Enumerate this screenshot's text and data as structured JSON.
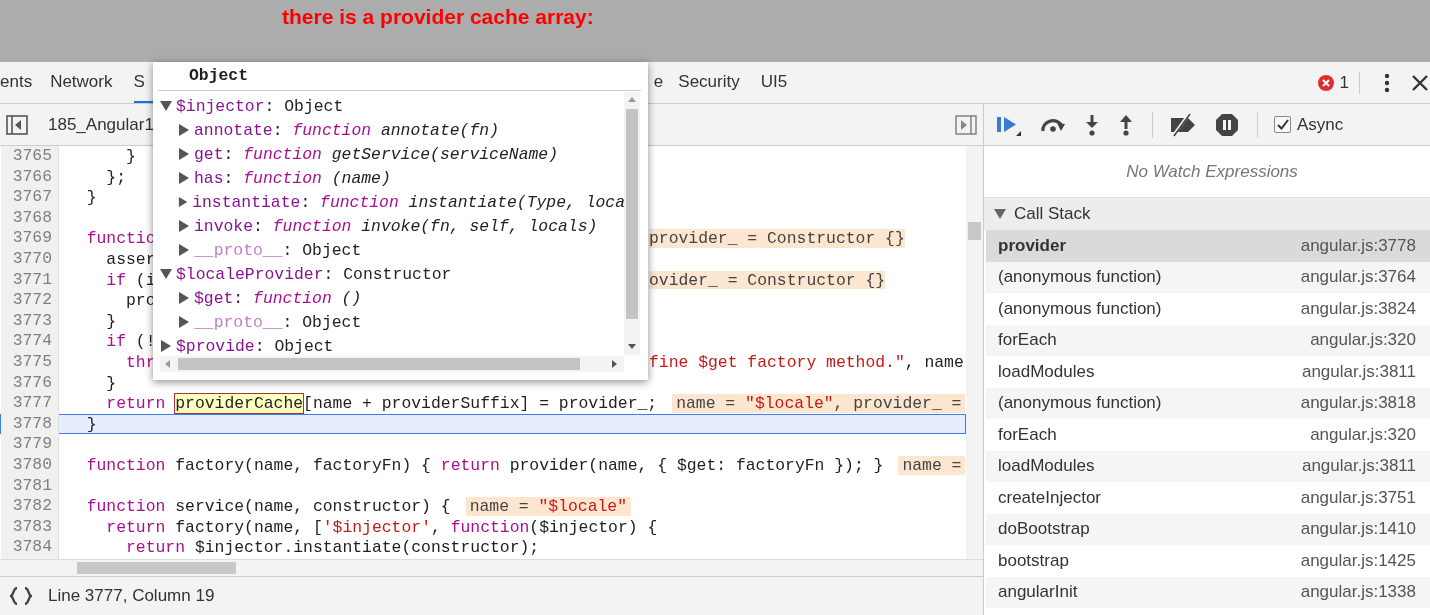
{
  "banner": {
    "text": "there is a provider cache array:"
  },
  "tabs": [
    {
      "label": "ents",
      "selected": false
    },
    {
      "label": "Network",
      "selected": false
    },
    {
      "label": "S",
      "selected": true
    },
    {
      "label": "e",
      "selected": false
    },
    {
      "label": "Security",
      "selected": false
    },
    {
      "label": "UI5",
      "selected": false
    }
  ],
  "errors": {
    "count": "1"
  },
  "editor": {
    "file_tab": "185_Angular1",
    "status": "Line 3777, Column 19",
    "lines": [
      {
        "number": "3765",
        "current": false,
        "tokens": [
          "      }"
        ]
      },
      {
        "number": "3766",
        "current": false,
        "tokens": [
          "    };"
        ]
      },
      {
        "number": "3767",
        "current": false,
        "tokens": [
          "  }"
        ]
      },
      {
        "number": "3768",
        "current": false
      },
      {
        "number": "3769",
        "current": false,
        "tokens": [
          {
            "kind": "keyword",
            "text": "  functio"
          }
        ],
        "right": [
          {
            "kind": "value",
            "tokens": [
              "provider_ = Constructor {}"
            ]
          }
        ]
      },
      {
        "number": "3770",
        "current": false,
        "tokens": [
          "    asser"
        ]
      },
      {
        "number": "3771",
        "current": false,
        "tokens": [
          {
            "kind": "keyword",
            "text": "    if"
          },
          " (i"
        ],
        "right": [
          {
            "kind": "value",
            "tokens": [
              "ovider_ = Constructor {}"
            ]
          }
        ]
      },
      {
        "number": "3772",
        "current": false,
        "tokens": [
          "      pro"
        ]
      },
      {
        "number": "3773",
        "current": false,
        "tokens": [
          "    }"
        ]
      },
      {
        "number": "3774",
        "current": false,
        "tokens": [
          {
            "kind": "keyword",
            "text": "    if"
          },
          " (!"
        ]
      },
      {
        "number": "3775",
        "current": false,
        "tokens": [
          {
            "kind": "keyword",
            "text": "      thr"
          }
        ],
        "right": [
          {
            "kind": "code",
            "tokens": [
              {
                "kind": "string",
                "text": "fine $get factory method.\""
              },
              ", name"
            ]
          }
        ]
      },
      {
        "number": "3776",
        "current": false,
        "tokens": [
          "    }"
        ]
      },
      {
        "number": "3777",
        "current": false,
        "tokens": [
          {
            "kind": "keyword",
            "text": "    return "
          },
          {
            "kind": "highlight",
            "text": "providerCache"
          },
          "[name + providerSuffix] = provider_;"
        ],
        "value": [
          "name = ",
          {
            "kind": "string",
            "text": "\"$locale\""
          },
          ", provider_ ="
        ]
      },
      {
        "number": "3778",
        "current": true,
        "tokens": [
          "  }"
        ]
      },
      {
        "number": "3779",
        "current": false
      },
      {
        "number": "3780",
        "current": false,
        "tokens": [
          {
            "kind": "keyword",
            "text": "  function"
          },
          " factory(name, factoryFn) { ",
          {
            "kind": "keyword",
            "text": "return"
          },
          " provider(name, { $get: factoryFn }); }"
        ],
        "value": [
          "name ="
        ]
      },
      {
        "number": "3781",
        "current": false
      },
      {
        "number": "3782",
        "current": false,
        "tokens": [
          {
            "kind": "keyword",
            "text": "  function"
          },
          " service(name, constructor) {"
        ],
        "value": [
          "name = ",
          {
            "kind": "string",
            "text": "\"$locale\""
          }
        ]
      },
      {
        "number": "3783",
        "current": false,
        "tokens": [
          {
            "kind": "keyword",
            "text": "    return"
          },
          " factory(name, [",
          {
            "kind": "string",
            "text": "'$injector'"
          },
          ", ",
          {
            "kind": "keyword",
            "text": "function"
          },
          "($injector) {"
        ]
      },
      {
        "number": "3784",
        "current": false,
        "tokens": [
          {
            "kind": "keyword",
            "text": "      return"
          },
          " $injector.instantiate(constructor);"
        ]
      }
    ]
  },
  "popover": {
    "title": "Object",
    "properties": [
      {
        "expanded": true,
        "tokens": [
          {
            "kind": "key",
            "text": "$injector"
          },
          ": Object"
        ],
        "children": [
          {
            "expanded": false,
            "tokens": [
              {
                "kind": "key",
                "text": "annotate"
              },
              ": ",
              {
                "kind": "fn",
                "text": "function"
              },
              {
                "kind": "sig",
                "text": " annotate(fn)"
              }
            ]
          },
          {
            "expanded": false,
            "tokens": [
              {
                "kind": "key",
                "text": "get"
              },
              ": ",
              {
                "kind": "fn",
                "text": "function"
              },
              {
                "kind": "sig",
                "text": " getService(serviceName)"
              }
            ]
          },
          {
            "expanded": false,
            "tokens": [
              {
                "kind": "key",
                "text": "has"
              },
              ": ",
              {
                "kind": "fn",
                "text": "function"
              },
              {
                "kind": "sig",
                "text": " (name)"
              }
            ]
          },
          {
            "expanded": false,
            "tokens": [
              {
                "kind": "key",
                "text": "instantiate"
              },
              ": ",
              {
                "kind": "fn",
                "text": "function"
              },
              {
                "kind": "sig",
                "text": " instantiate(Type, loca"
              }
            ]
          },
          {
            "expanded": false,
            "tokens": [
              {
                "kind": "key",
                "text": "invoke"
              },
              ": ",
              {
                "kind": "fn",
                "text": "function"
              },
              {
                "kind": "sig",
                "text": " invoke(fn, self, locals)"
              }
            ]
          },
          {
            "expanded": false,
            "tokens": [
              {
                "kind": "dimkey",
                "text": "__proto__"
              },
              ": Object"
            ]
          }
        ]
      },
      {
        "expanded": true,
        "tokens": [
          {
            "kind": "key",
            "text": "$localeProvider"
          },
          ": Constructor"
        ],
        "children": [
          {
            "expanded": false,
            "tokens": [
              {
                "kind": "key",
                "text": "$get"
              },
              ": ",
              {
                "kind": "fn",
                "text": "function"
              },
              {
                "kind": "sig",
                "text": " ()"
              }
            ]
          },
          {
            "expanded": false,
            "tokens": [
              {
                "kind": "dimkey",
                "text": "__proto__"
              },
              ": Object"
            ]
          }
        ]
      },
      {
        "expanded": false,
        "tokens": [
          {
            "kind": "key",
            "text": "$provide"
          },
          ": Object"
        ]
      }
    ]
  },
  "debugger": {
    "async": {
      "label": "Async",
      "checked": true
    },
    "watch_placeholder": "No Watch Expressions",
    "call_stack": {
      "title": "Call Stack",
      "expanded": true,
      "frames": [
        {
          "name": "provider",
          "location": "angular.js:3778",
          "selected": true
        },
        {
          "name": "(anonymous function)",
          "location": "angular.js:3764",
          "selected": false
        },
        {
          "name": "(anonymous function)",
          "location": "angular.js:3824",
          "selected": false
        },
        {
          "name": "forEach",
          "location": "angular.js:320",
          "selected": false
        },
        {
          "name": "loadModules",
          "location": "angular.js:3811",
          "selected": false
        },
        {
          "name": "(anonymous function)",
          "location": "angular.js:3818",
          "selected": false
        },
        {
          "name": "forEach",
          "location": "angular.js:320",
          "selected": false
        },
        {
          "name": "loadModules",
          "location": "angular.js:3811",
          "selected": false
        },
        {
          "name": "createInjector",
          "location": "angular.js:3751",
          "selected": false
        },
        {
          "name": "doBootstrap",
          "location": "angular.js:1410",
          "selected": false
        },
        {
          "name": "bootstrap",
          "location": "angular.js:1425",
          "selected": false
        },
        {
          "name": "angularInit",
          "location": "angular.js:1338",
          "selected": false
        }
      ]
    }
  }
}
